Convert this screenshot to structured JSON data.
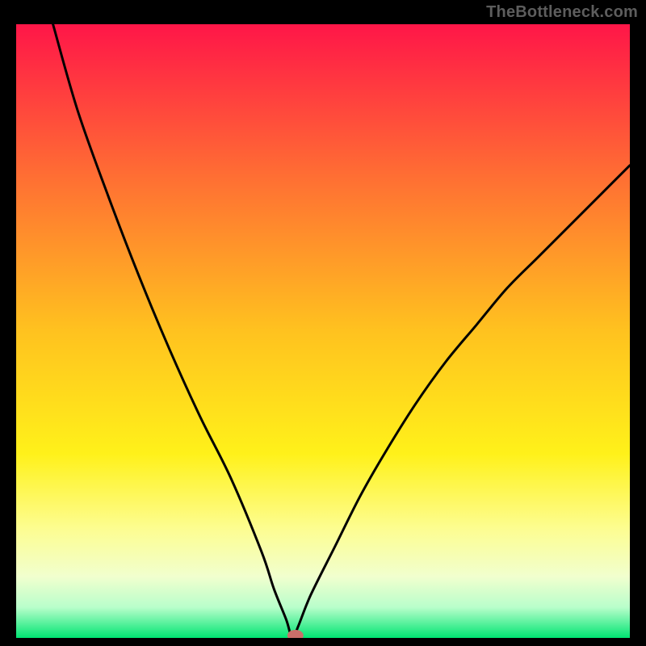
{
  "watermark": "TheBottleneck.com",
  "chart_data": {
    "type": "line",
    "title": "",
    "xlabel": "",
    "ylabel": "",
    "xlim": [
      0,
      100
    ],
    "ylim": [
      0,
      100
    ],
    "grid": false,
    "series": [
      {
        "name": "curve",
        "x": [
          6,
          10,
          15,
          20,
          25,
          30,
          35,
          40,
          42,
          44,
          45,
          46,
          48,
          52,
          56,
          60,
          65,
          70,
          75,
          80,
          85,
          90,
          95,
          100
        ],
        "values": [
          100,
          86,
          72,
          59,
          47,
          36,
          26,
          14,
          8,
          3,
          0,
          2,
          7,
          15,
          23,
          30,
          38,
          45,
          51,
          57,
          62,
          67,
          72,
          77
        ]
      }
    ],
    "marker": {
      "x": 45.5,
      "y": 0,
      "color": "#c96f6a"
    },
    "gradient_stops": [
      {
        "offset": 0.0,
        "color": "#ff1648"
      },
      {
        "offset": 0.25,
        "color": "#ff6f33"
      },
      {
        "offset": 0.5,
        "color": "#ffc21f"
      },
      {
        "offset": 0.7,
        "color": "#fff11a"
      },
      {
        "offset": 0.82,
        "color": "#fdfd8f"
      },
      {
        "offset": 0.9,
        "color": "#f1ffce"
      },
      {
        "offset": 0.95,
        "color": "#b9fecb"
      },
      {
        "offset": 1.0,
        "color": "#00e572"
      }
    ],
    "curve_stroke": "#000000",
    "curve_width": 3
  }
}
